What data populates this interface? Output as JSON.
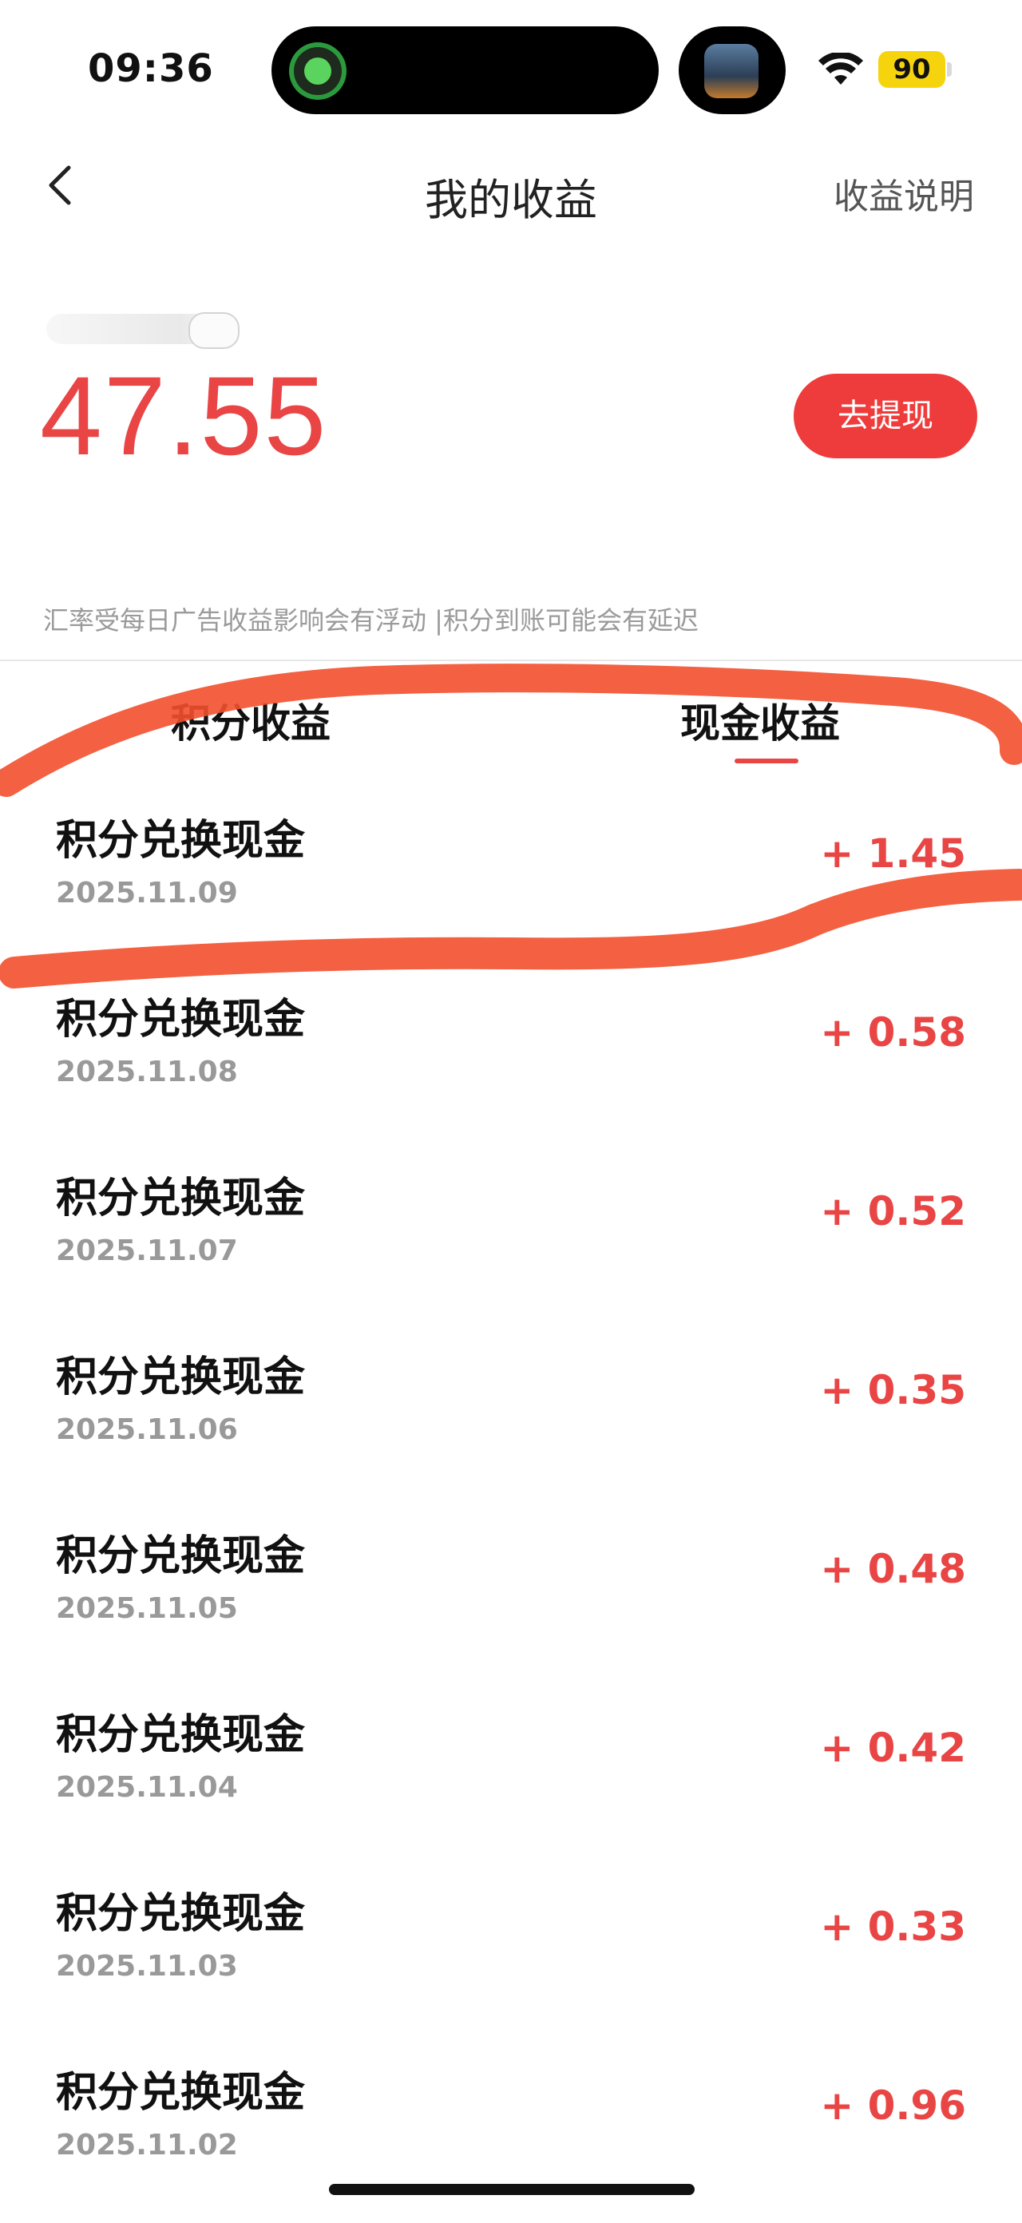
{
  "status_bar": {
    "time": "09:36",
    "battery": "90",
    "icons": [
      "activity-app-icon",
      "music-thumbnail-icon",
      "wifi-icon",
      "battery-icon"
    ]
  },
  "header": {
    "title": "我的收益",
    "right_link": "收益说明",
    "back_icon": "chevron-left-icon"
  },
  "balance": {
    "amount": "47.55",
    "withdraw_label": "去提现"
  },
  "notice": "汇率受每日广告收益影响会有浮动 |积分到账可能会有延迟",
  "tabs": [
    {
      "label": "积分收益",
      "active": false
    },
    {
      "label": "现金收益",
      "active": true
    }
  ],
  "records": [
    {
      "title": "积分兑换现金",
      "date": "2025.11.09",
      "amount": "+ 1.45"
    },
    {
      "title": "积分兑换现金",
      "date": "2025.11.08",
      "amount": "+ 0.58"
    },
    {
      "title": "积分兑换现金",
      "date": "2025.11.07",
      "amount": "+ 0.52"
    },
    {
      "title": "积分兑换现金",
      "date": "2025.11.06",
      "amount": "+ 0.35"
    },
    {
      "title": "积分兑换现金",
      "date": "2025.11.05",
      "amount": "+ 0.48"
    },
    {
      "title": "积分兑换现金",
      "date": "2025.11.04",
      "amount": "+ 0.42"
    },
    {
      "title": "积分兑换现金",
      "date": "2025.11.03",
      "amount": "+ 0.33"
    },
    {
      "title": "积分兑换现金",
      "date": "2025.11.02",
      "amount": "+ 0.96"
    }
  ],
  "colors": {
    "accent": "#e94545",
    "button": "#ee3c3c",
    "scribble": "#f2502e",
    "battery": "#f6d40d"
  }
}
